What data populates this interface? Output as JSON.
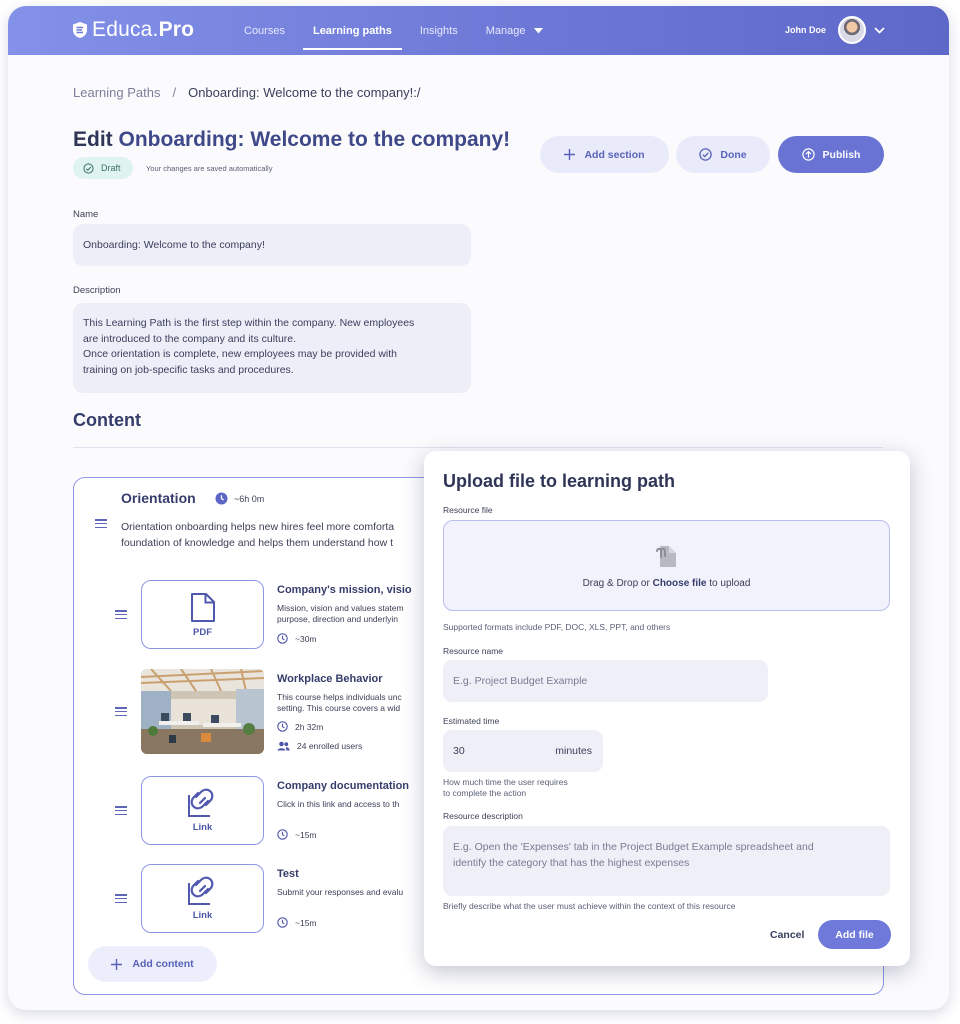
{
  "app": {
    "logo_main": "Educa",
    "logo_dot": ".",
    "logo_pro": "Pro"
  },
  "nav": {
    "items": [
      {
        "label": "Courses"
      },
      {
        "label": "Learning paths"
      },
      {
        "label": "Insights"
      },
      {
        "label": "Manage"
      }
    ],
    "active": "Learning paths"
  },
  "user": {
    "name": "John Doe"
  },
  "breadcrumb": {
    "root": "Learning Paths",
    "separator": "/",
    "current": "Onboarding: Welcome to the company!:/"
  },
  "page": {
    "title_prefix": "Edit",
    "title_name": "Onboarding: Welcome to the company!",
    "status": "Draft",
    "saved_note": "Your changes are saved automatically"
  },
  "actions": {
    "add_section": "Add section",
    "done": "Done",
    "publish": "Publish"
  },
  "form": {
    "name_label": "Name",
    "name_value": "Onboarding: Welcome to the company!",
    "description_label": "Description",
    "description_lines": [
      "This Learning Path is the first step within the company. New employees",
      "are introduced to the company and its culture.",
      "Once orientation is complete, new employees may be provided with",
      "training on job-specific tasks and procedures."
    ]
  },
  "content": {
    "heading": "Content",
    "section": {
      "title": "Orientation",
      "duration": "~6h 0m",
      "desc_lines": [
        "Orientation onboarding helps new hires feel more comforta",
        "foundation of knowledge and helps them understand how t"
      ]
    },
    "items": [
      {
        "card_label": "PDF",
        "title": "Company's mission, visio",
        "desc_lines": [
          "Mission, vision and values statem",
          "purpose, direction and underlyin"
        ],
        "time": "~30m"
      },
      {
        "title": "Workplace Behavior",
        "desc_lines": [
          "This course helps individuals unc",
          "setting. This course covers a wid"
        ],
        "time": "2h 32m",
        "enrolled": "24 enrolled users"
      },
      {
        "card_label": "Link",
        "title": "Company documentation",
        "desc_lines": [
          "Click in this link and access to th"
        ],
        "time": "~15m"
      },
      {
        "card_label": "Link",
        "title": "Test",
        "desc_lines": [
          "Submit your responses and evalu"
        ],
        "time": "~15m"
      }
    ],
    "add_content": "Add content"
  },
  "modal": {
    "title": "Upload file to learning path",
    "resource_file_label": "Resource file",
    "drop_prefix": "Drag & Drop or",
    "drop_link": "Choose file",
    "drop_suffix": "to upload",
    "formats_hint": "Supported formats include PDF, DOC, XLS, PPT, and others",
    "resource_name_label": "Resource name",
    "resource_name_placeholder": "E.g. Project Budget Example",
    "estimated_time_label": "Estimated time",
    "estimated_time_value": "30",
    "estimated_time_unit": "minutes",
    "time_hint_lines": [
      "How much time the user requires",
      "to complete the action"
    ],
    "resource_description_label": "Resource description",
    "description_placeholder_lines": [
      "E.g. Open the 'Expenses' tab in the Project Budget Example spreadsheet and",
      "identify the category that has the highest expenses"
    ],
    "description_hint": "Briefly describe what the user must achieve within the context of this resource",
    "cancel": "Cancel",
    "add_file": "Add file"
  },
  "colors": {
    "primary": "#6873d3",
    "accent_light": "#e9ebfb",
    "draft_bg": "#dff4f1"
  }
}
